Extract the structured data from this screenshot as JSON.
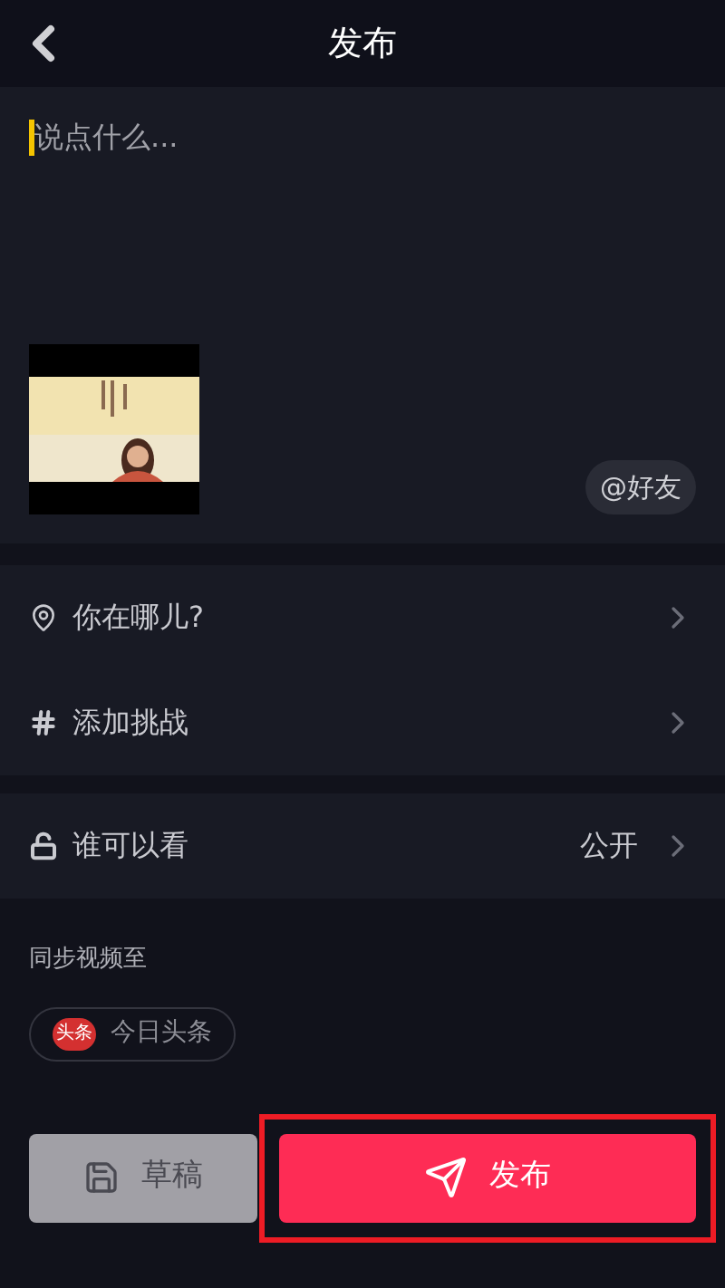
{
  "header": {
    "title": "发布"
  },
  "compose": {
    "placeholder": "说点什么...",
    "mention_button": "@好友"
  },
  "options": [
    {
      "kind": "location",
      "label": "你在哪儿?"
    },
    {
      "kind": "hashtag",
      "label": "添加挑战"
    }
  ],
  "privacy": {
    "label": "谁可以看",
    "value": "公开"
  },
  "sync": {
    "title": "同步视频至",
    "targets": [
      {
        "logo": "头条",
        "label": "今日头条",
        "selected": false
      }
    ]
  },
  "actions": {
    "draft": "草稿",
    "publish": "发布",
    "publish_highlighted": true
  }
}
